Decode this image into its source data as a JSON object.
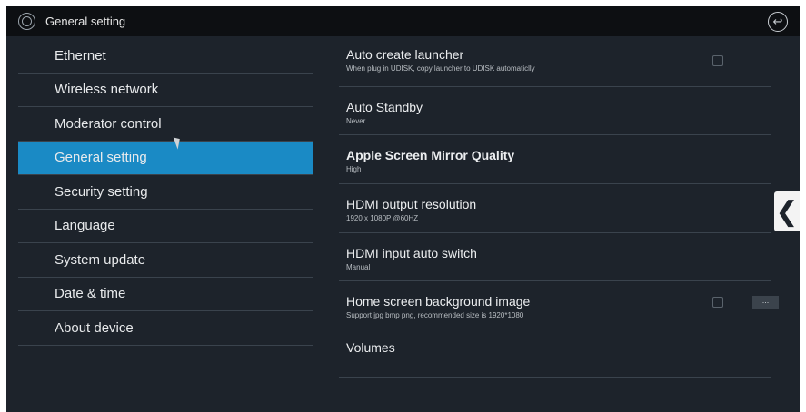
{
  "titlebar": {
    "title": "General setting",
    "settings_icon": "gear-icon",
    "back_icon": "back-arrow-icon"
  },
  "sidebar": {
    "items": [
      {
        "label": "Ethernet"
      },
      {
        "label": "Wireless network"
      },
      {
        "label": "Moderator control"
      },
      {
        "label": "General setting",
        "active": true
      },
      {
        "label": "Security setting"
      },
      {
        "label": "Language"
      },
      {
        "label": "System update"
      },
      {
        "label": "Date & time"
      },
      {
        "label": "About device"
      }
    ]
  },
  "settings": [
    {
      "title": "Auto create launcher",
      "subtitle": "When plug in UDISK, copy launcher to UDISK automaticlly",
      "has_checkbox": true
    },
    {
      "title": "Auto Standby",
      "subtitle": "Never"
    },
    {
      "title": "Apple Screen Mirror Quality",
      "subtitle": "High"
    },
    {
      "title": "HDMI output resolution",
      "subtitle": "1920 x 1080P @60HZ"
    },
    {
      "title": "HDMI input auto switch",
      "subtitle": "Manual"
    },
    {
      "title": "Home screen background image",
      "subtitle": "Support jpg bmp png, recommended size is 1920*1080",
      "has_checkbox": true,
      "more_label": "..."
    },
    {
      "title": "Volumes",
      "subtitle": ""
    }
  ],
  "drawer": {
    "icon": "chevron-left-icon",
    "glyph": "❮"
  },
  "colors": {
    "accent": "#1a8ac5",
    "background": "#1d232b",
    "titlebar": "#0d0f12"
  }
}
